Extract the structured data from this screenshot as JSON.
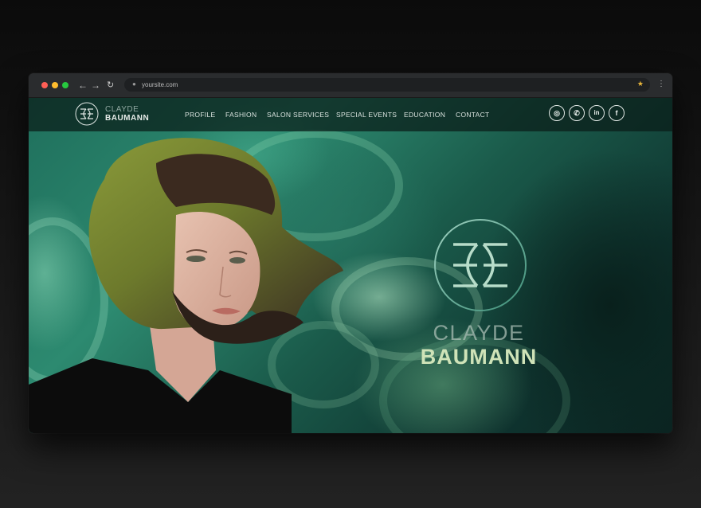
{
  "browser": {
    "url": "yoursite.com",
    "icons": {
      "back": "arrow-left-icon",
      "forward": "arrow-right-icon",
      "reload": "reload-icon",
      "lock": "lock-icon",
      "bookmark": "star-icon",
      "menu": "kebab-menu-icon"
    }
  },
  "site": {
    "logo": {
      "line1": "CLAYDE",
      "line2": "BAUMANN"
    },
    "menu": [
      "PROFILE",
      "FASHION",
      "SALON SERVICES",
      "SPECIAL EVENTS",
      "EDUCATION",
      "CONTACT"
    ],
    "social": [
      {
        "name": "instagram",
        "icon": "instagram-icon",
        "glyph": "◎"
      },
      {
        "name": "whatsapp",
        "icon": "whatsapp-icon",
        "glyph": "✆"
      },
      {
        "name": "linkedin",
        "icon": "linkedin-icon",
        "glyph": "in"
      },
      {
        "name": "facebook",
        "icon": "facebook-icon",
        "glyph": "f"
      }
    ]
  },
  "hero": {
    "title_line1": "CLAYDE",
    "title_line2": "BAUMANN"
  },
  "colors": {
    "accent": "#cfe3b8",
    "background_teal": "#1f6f5c",
    "nav_overlay": "#0a1c18"
  }
}
